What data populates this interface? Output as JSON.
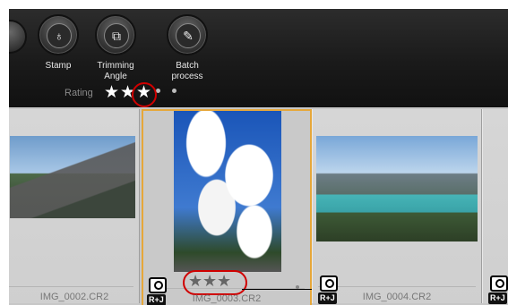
{
  "toolbar": {
    "tools": [
      {
        "label": "Stamp",
        "icon": "stamp-icon",
        "glyph": "♁"
      },
      {
        "label": "Trimming\nAngle",
        "icon": "trimming-angle-icon",
        "glyph": "⧉"
      },
      {
        "label": "Batch\nprocess",
        "icon": "batch-process-icon",
        "glyph": "✎"
      }
    ],
    "rating_label": "Rating",
    "rating": {
      "stars": 3,
      "max": 5
    }
  },
  "filmstrip": {
    "cells": [
      {
        "filename": "IMG_0002.CR2",
        "selected": false
      },
      {
        "filename": "IMG_0003.CR2",
        "selected": true,
        "stars": 3
      },
      {
        "filename": "IMG_0004.CR2",
        "selected": false
      }
    ],
    "raw_jpeg_badge": "R+J"
  },
  "colors": {
    "annotation": "#d00000",
    "selection": "#e6a73a"
  }
}
